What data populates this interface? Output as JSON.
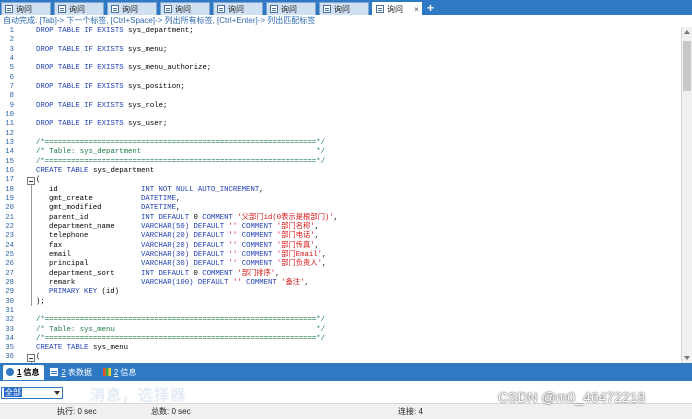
{
  "tabs": [
    {
      "label": "询问",
      "active": false
    },
    {
      "label": "询问",
      "active": false
    },
    {
      "label": "询问",
      "active": false
    },
    {
      "label": "询问",
      "active": false
    },
    {
      "label": "询问",
      "active": false
    },
    {
      "label": "询问",
      "active": false
    },
    {
      "label": "询问",
      "active": false
    },
    {
      "label": "询问",
      "active": true
    }
  ],
  "tab_add": "+",
  "tab_close": "×",
  "hint": "自动完成: [Tab]-> 下一个标签, [Ctrl+Space]-> 列出所有标签, [Ctrl+Enter]-> 列出匹配标签",
  "code_lines": [
    {
      "n": "1",
      "segs": [
        [
          "kw",
          "DROP TABLE IF EXISTS "
        ],
        [
          "id",
          "sys_department;"
        ]
      ]
    },
    {
      "n": "2",
      "segs": []
    },
    {
      "n": "3",
      "segs": [
        [
          "kw",
          "DROP TABLE IF EXISTS "
        ],
        [
          "id",
          "sys_menu;"
        ]
      ]
    },
    {
      "n": "4",
      "segs": []
    },
    {
      "n": "5",
      "segs": [
        [
          "kw",
          "DROP TABLE IF EXISTS "
        ],
        [
          "id",
          "sys_menu_authorize;"
        ]
      ]
    },
    {
      "n": "6",
      "segs": []
    },
    {
      "n": "7",
      "segs": [
        [
          "kw",
          "DROP TABLE IF EXISTS "
        ],
        [
          "id",
          "sys_position;"
        ]
      ]
    },
    {
      "n": "8",
      "segs": []
    },
    {
      "n": "9",
      "segs": [
        [
          "kw",
          "DROP TABLE IF EXISTS "
        ],
        [
          "id",
          "sys_role;"
        ]
      ]
    },
    {
      "n": "10",
      "segs": []
    },
    {
      "n": "11",
      "segs": [
        [
          "kw",
          "DROP TABLE IF EXISTS "
        ],
        [
          "id",
          "sys_user;"
        ]
      ]
    },
    {
      "n": "12",
      "segs": []
    },
    {
      "n": "13",
      "segs": [
        [
          "cm",
          "/*==============================================================*/"
        ]
      ]
    },
    {
      "n": "14",
      "segs": [
        [
          "cm",
          "/* Table: sys_department                                        */"
        ]
      ]
    },
    {
      "n": "15",
      "segs": [
        [
          "cm",
          "/*==============================================================*/"
        ]
      ]
    },
    {
      "n": "16",
      "segs": [
        [
          "kw",
          "CREATE TABLE "
        ],
        [
          "id",
          "sys_department"
        ]
      ]
    },
    {
      "n": "17",
      "fold": true,
      "segs": [
        [
          "id",
          "("
        ]
      ]
    },
    {
      "n": "18",
      "indent": true,
      "segs": [
        [
          "id",
          "id                   "
        ],
        [
          "kw",
          "INT NOT NULL AUTO_INCREMENT"
        ],
        [
          "id",
          ","
        ]
      ]
    },
    {
      "n": "19",
      "indent": true,
      "segs": [
        [
          "id",
          "gmt_create           "
        ],
        [
          "kw",
          "DATETIME"
        ],
        [
          "id",
          ","
        ]
      ]
    },
    {
      "n": "20",
      "indent": true,
      "segs": [
        [
          "id",
          "gmt_modified         "
        ],
        [
          "kw",
          "DATETIME"
        ],
        [
          "id",
          ","
        ]
      ]
    },
    {
      "n": "21",
      "indent": true,
      "segs": [
        [
          "id",
          "parent_id            "
        ],
        [
          "kw",
          "INT DEFAULT "
        ],
        [
          "id",
          "0 "
        ],
        [
          "kw",
          "COMMENT "
        ],
        [
          "st",
          "'父部门id(0表示是根部门)'"
        ],
        [
          "id",
          ","
        ]
      ]
    },
    {
      "n": "22",
      "indent": true,
      "segs": [
        [
          "id",
          "department_name      "
        ],
        [
          "kw",
          "VARCHAR(50) DEFAULT "
        ],
        [
          "st",
          "'' "
        ],
        [
          "kw",
          "COMMENT "
        ],
        [
          "st",
          "'部门名称'"
        ],
        [
          "id",
          ","
        ]
      ]
    },
    {
      "n": "23",
      "indent": true,
      "segs": [
        [
          "id",
          "telephone            "
        ],
        [
          "kw",
          "VARCHAR(20) DEFAULT "
        ],
        [
          "st",
          "'' "
        ],
        [
          "kw",
          "COMMENT "
        ],
        [
          "st",
          "'部门电话'"
        ],
        [
          "id",
          ","
        ]
      ]
    },
    {
      "n": "24",
      "indent": true,
      "segs": [
        [
          "id",
          "fax                  "
        ],
        [
          "kw",
          "VARCHAR(20) DEFAULT "
        ],
        [
          "st",
          "'' "
        ],
        [
          "kw",
          "COMMENT "
        ],
        [
          "st",
          "'部门传真'"
        ],
        [
          "id",
          ","
        ]
      ]
    },
    {
      "n": "25",
      "indent": true,
      "segs": [
        [
          "id",
          "email                "
        ],
        [
          "kw",
          "VARCHAR(30) DEFAULT "
        ],
        [
          "st",
          "'' "
        ],
        [
          "kw",
          "COMMENT "
        ],
        [
          "st",
          "'部门Email'"
        ],
        [
          "id",
          ","
        ]
      ]
    },
    {
      "n": "26",
      "indent": true,
      "segs": [
        [
          "id",
          "principal            "
        ],
        [
          "kw",
          "VARCHAR(30) DEFAULT "
        ],
        [
          "st",
          "'' "
        ],
        [
          "kw",
          "COMMENT "
        ],
        [
          "st",
          "'部门负责人'"
        ],
        [
          "id",
          ","
        ]
      ]
    },
    {
      "n": "27",
      "indent": true,
      "segs": [
        [
          "id",
          "department_sort      "
        ],
        [
          "kw",
          "INT DEFAULT "
        ],
        [
          "id",
          "0 "
        ],
        [
          "kw",
          "COMMENT "
        ],
        [
          "st",
          "'部门排序'"
        ],
        [
          "id",
          ","
        ]
      ]
    },
    {
      "n": "28",
      "indent": true,
      "segs": [
        [
          "id",
          "remark               "
        ],
        [
          "kw",
          "VARCHAR(100) DEFAULT "
        ],
        [
          "st",
          "'' "
        ],
        [
          "kw",
          "COMMENT "
        ],
        [
          "st",
          "'备注'"
        ],
        [
          "id",
          ","
        ]
      ]
    },
    {
      "n": "29",
      "indent": true,
      "segs": [
        [
          "kw",
          "PRIMARY KEY "
        ],
        [
          "id",
          "(id)"
        ]
      ]
    },
    {
      "n": "30",
      "segs": [
        [
          "id",
          ");"
        ]
      ]
    },
    {
      "n": "31",
      "segs": []
    },
    {
      "n": "32",
      "segs": [
        [
          "cm",
          "/*==============================================================*/"
        ]
      ]
    },
    {
      "n": "33",
      "segs": [
        [
          "cm",
          "/* Table: sys_menu                                              */"
        ]
      ]
    },
    {
      "n": "34",
      "segs": [
        [
          "cm",
          "/*==============================================================*/"
        ]
      ]
    },
    {
      "n": "35",
      "segs": [
        [
          "kw",
          "CREATE TABLE "
        ],
        [
          "id",
          "sys_menu"
        ]
      ]
    },
    {
      "n": "36",
      "fold": true,
      "segs": [
        [
          "id",
          "("
        ]
      ]
    }
  ],
  "panel_tabs": [
    {
      "num": "1",
      "label": "信息",
      "icon": "info",
      "active": true
    },
    {
      "num": "2",
      "label": "表数据",
      "icon": "grid",
      "active": false
    },
    {
      "num": "2",
      "label": "信息",
      "icon": "chart",
      "active": false
    }
  ],
  "message_filter": "全部",
  "faint_text": "消息，选择器",
  "status": {
    "exec": "执行: 0 sec",
    "total": "总数: 0 sec",
    "connections": "连接: 4"
  },
  "watermark": "CSDN @m0_46472218",
  "colors": {
    "accent": "#2f78c4",
    "keyword": "#1f3eb3",
    "comment": "#1a7a45",
    "string": "#d81414",
    "line_number": "#2a62a8"
  }
}
